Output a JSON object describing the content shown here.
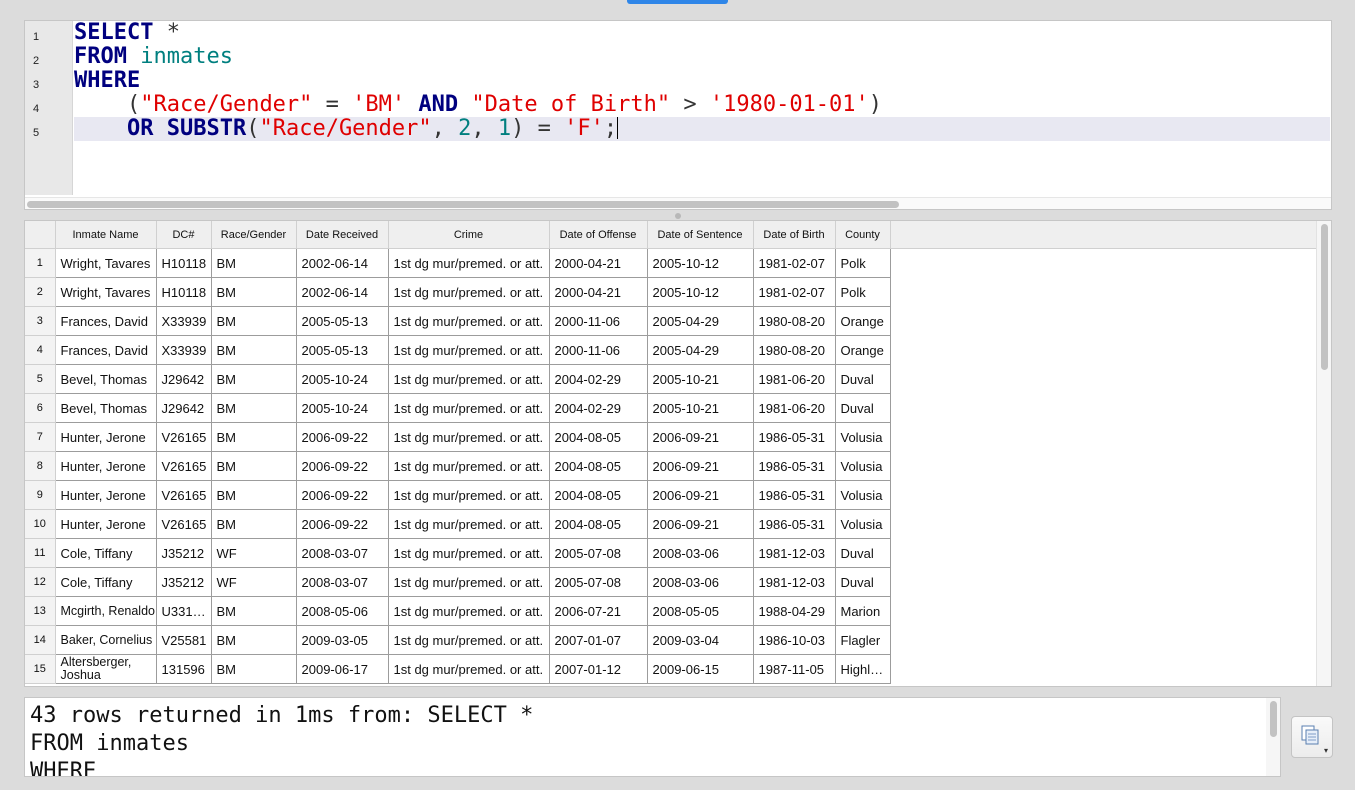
{
  "editor": {
    "line_numbers": [
      "1",
      "2",
      "3",
      "4",
      "5"
    ],
    "tokens": {
      "select": "SELECT",
      "star": " *",
      "from": "FROM",
      "table": "inmates",
      "where": "WHERE",
      "indent4": "    ",
      "open_paren": "(",
      "race_col": "\"Race/Gender\"",
      "eq": " = ",
      "bm": "'BM'",
      "and": "AND",
      "dob_col": "\"Date of Birth\"",
      "gt": " > ",
      "date": "'1980-01-01'",
      "close_paren": ")",
      "or": "OR",
      "substr": "SUBSTR",
      "comma_sp": ", ",
      "two": "2",
      "one": "1",
      "close_paren_eq": ") = ",
      "f": "'F'",
      "semi": ";"
    }
  },
  "grid": {
    "columns": [
      "Inmate Name",
      "DC#",
      "Race/Gender",
      "Date Received",
      "Crime",
      "Date of Offense",
      "Date of Sentence",
      "Date of Birth",
      "County"
    ],
    "rows": [
      [
        "1",
        "Wright, Tavares",
        "H10118",
        "BM",
        "2002-06-14",
        "1st dg mur/premed. or att.",
        "2000-04-21",
        "2005-10-12",
        "1981-02-07",
        "Polk"
      ],
      [
        "2",
        "Wright, Tavares",
        "H10118",
        "BM",
        "2002-06-14",
        "1st dg mur/premed. or att.",
        "2000-04-21",
        "2005-10-12",
        "1981-02-07",
        "Polk"
      ],
      [
        "3",
        "Frances, David",
        "X33939",
        "BM",
        "2005-05-13",
        "1st dg mur/premed. or att.",
        "2000-11-06",
        "2005-04-29",
        "1980-08-20",
        "Orange"
      ],
      [
        "4",
        "Frances, David",
        "X33939",
        "BM",
        "2005-05-13",
        "1st dg mur/premed. or att.",
        "2000-11-06",
        "2005-04-29",
        "1980-08-20",
        "Orange"
      ],
      [
        "5",
        "Bevel, Thomas",
        "J29642",
        "BM",
        "2005-10-24",
        "1st dg mur/premed. or att.",
        "2004-02-29",
        "2005-10-21",
        "1981-06-20",
        "Duval"
      ],
      [
        "6",
        "Bevel, Thomas",
        "J29642",
        "BM",
        "2005-10-24",
        "1st dg mur/premed. or att.",
        "2004-02-29",
        "2005-10-21",
        "1981-06-20",
        "Duval"
      ],
      [
        "7",
        "Hunter, Jerone",
        "V26165",
        "BM",
        "2006-09-22",
        "1st dg mur/premed. or att.",
        "2004-08-05",
        "2006-09-21",
        "1986-05-31",
        "Volusia"
      ],
      [
        "8",
        "Hunter, Jerone",
        "V26165",
        "BM",
        "2006-09-22",
        "1st dg mur/premed. or att.",
        "2004-08-05",
        "2006-09-21",
        "1986-05-31",
        "Volusia"
      ],
      [
        "9",
        "Hunter, Jerone",
        "V26165",
        "BM",
        "2006-09-22",
        "1st dg mur/premed. or att.",
        "2004-08-05",
        "2006-09-21",
        "1986-05-31",
        "Volusia"
      ],
      [
        "10",
        "Hunter, Jerone",
        "V26165",
        "BM",
        "2006-09-22",
        "1st dg mur/premed. or att.",
        "2004-08-05",
        "2006-09-21",
        "1986-05-31",
        "Volusia"
      ],
      [
        "11",
        "Cole, Tiffany",
        "J35212",
        "WF",
        "2008-03-07",
        "1st dg mur/premed. or att.",
        "2005-07-08",
        "2008-03-06",
        "1981-12-03",
        "Duval"
      ],
      [
        "12",
        "Cole, Tiffany",
        "J35212",
        "WF",
        "2008-03-07",
        "1st dg mur/premed. or att.",
        "2005-07-08",
        "2008-03-06",
        "1981-12-03",
        "Duval"
      ],
      [
        "13",
        "Mcgirth, Renaldo",
        "U331…",
        "BM",
        "2008-05-06",
        "1st dg mur/premed. or att.",
        "2006-07-21",
        "2008-05-05",
        "1988-04-29",
        "Marion"
      ],
      [
        "14",
        "Baker, Cornelius",
        "V25581",
        "BM",
        "2009-03-05",
        "1st dg mur/premed. or att.",
        "2007-01-07",
        "2009-03-04",
        "1986-10-03",
        "Flagler"
      ],
      [
        "15",
        "Altersberger, Joshua",
        "131596",
        "BM",
        "2009-06-17",
        "1st dg mur/premed. or att.",
        "2007-01-12",
        "2009-06-15",
        "1987-11-05",
        "Highl…"
      ]
    ]
  },
  "messages": {
    "lines": [
      "43 rows returned in 1ms from: SELECT *",
      "FROM inmates",
      "WHERE"
    ]
  },
  "copy_button": {
    "icon": "copy-results-icon",
    "dropdown_glyph": "▾"
  }
}
